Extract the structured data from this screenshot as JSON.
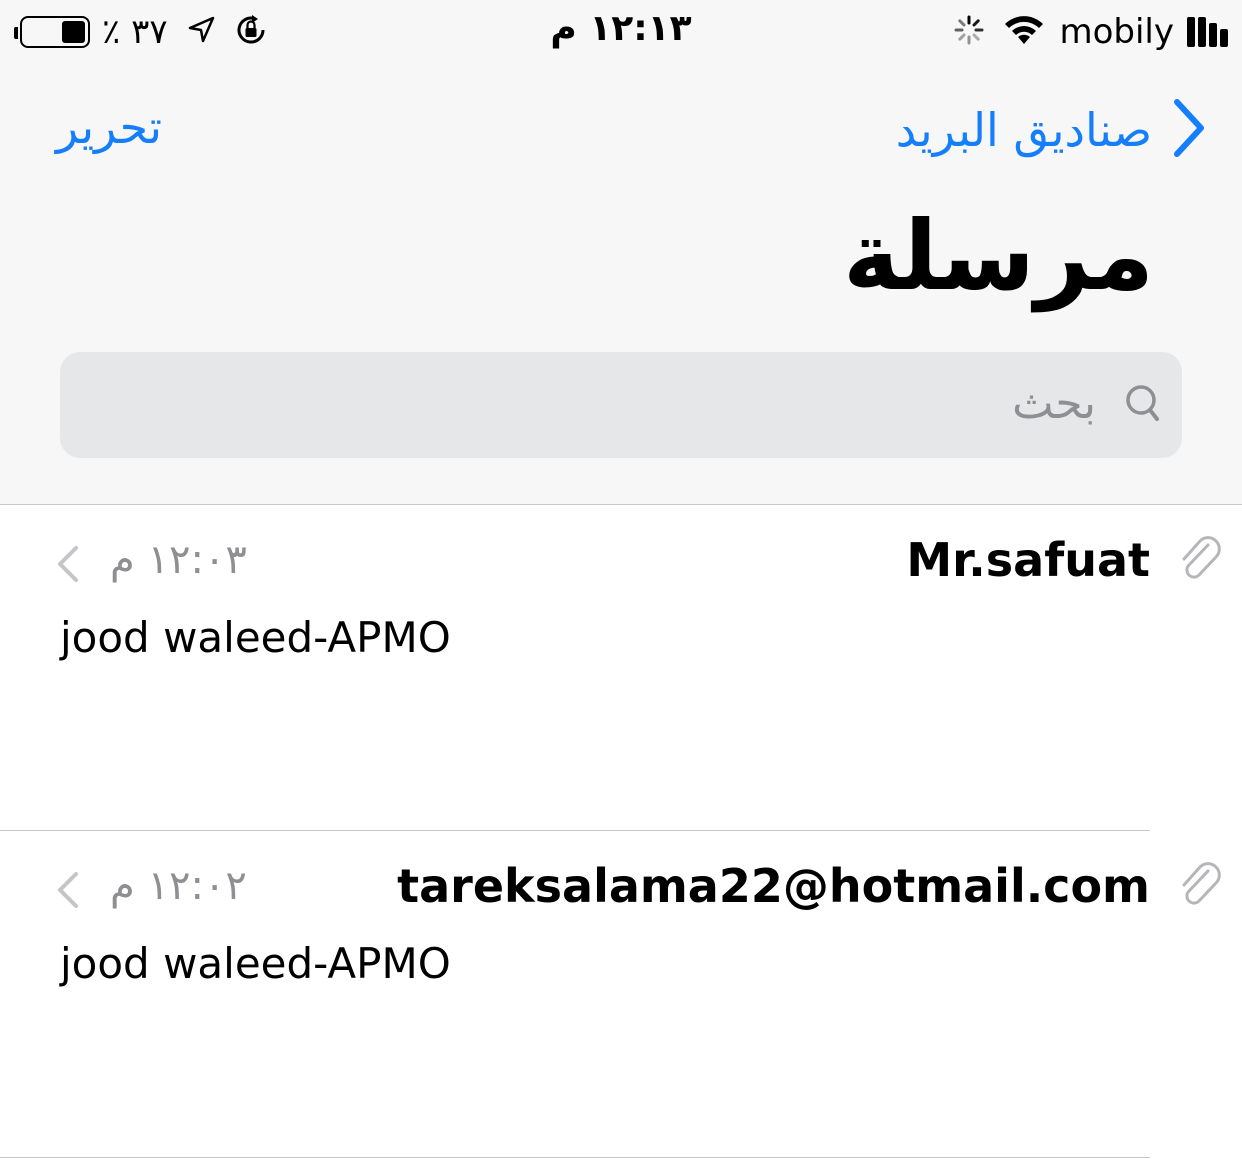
{
  "status_bar": {
    "battery_percent": "٪ ٣٧",
    "battery_level": 0.37,
    "time": "١٢:١٣ م",
    "carrier": "mobily",
    "icons": [
      "location-arrow-icon",
      "rotation-lock-icon",
      "activity-spinner-icon",
      "wifi-icon",
      "signal-bars-icon"
    ]
  },
  "nav": {
    "back_label": "صناديق البريد",
    "edit_label": "تحرير",
    "title": "مرسلة"
  },
  "search": {
    "placeholder": "بحث"
  },
  "colors": {
    "accent": "#147efb",
    "secondary_text": "#8e8e93",
    "header_bg": "#f7f7f7",
    "search_bg": "#e6e7e9"
  },
  "messages": [
    {
      "sender": "Mr.safuat",
      "time": "١٢:٠٣ م",
      "subject": "jood waleed-APMO",
      "has_attachment": true
    },
    {
      "sender": "tareksalama22@hotmail.com",
      "time": "١٢:٠٢ م",
      "subject": "jood waleed-APMO",
      "has_attachment": true
    }
  ]
}
